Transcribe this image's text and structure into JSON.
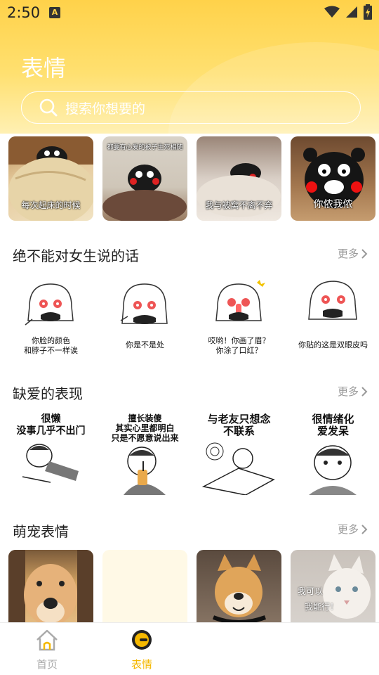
{
  "status_bar": {
    "time": "2:50",
    "notification_letter": "A"
  },
  "header": {
    "title": "表情",
    "search_placeholder": "搜索你想要的"
  },
  "top_thumbs": [
    {
      "caption": "每次起床的时候"
    },
    {
      "caption": "都要有心爱的被子生死相随"
    },
    {
      "caption": "我与被窝不离不弃"
    },
    {
      "caption": "你侬我侬"
    }
  ],
  "sections": [
    {
      "title": "绝不能对女生说的话",
      "more": "更多",
      "items": [
        {
          "lines": [
            "你脸的颜色",
            "和脖子不一样诶"
          ]
        },
        {
          "lines": [
            "你是不是处"
          ]
        },
        {
          "lines": [
            "哎哟！你画了眉？",
            "你涂了口红？"
          ]
        },
        {
          "lines": [
            "你贴的这是双眼皮吗"
          ]
        }
      ]
    },
    {
      "title": "缺爱的表现",
      "more": "更多",
      "items": [
        {
          "lines": [
            "很懒",
            "没事几乎不出门"
          ]
        },
        {
          "lines": [
            "擅长装傻",
            "其实心里都明白",
            "只是不愿意说出来"
          ]
        },
        {
          "lines": [
            "与老友只想念",
            "不联系"
          ]
        },
        {
          "lines": [
            "很情绪化",
            "爱发呆"
          ]
        }
      ]
    },
    {
      "title": "萌宠表情",
      "more": "更多",
      "items": [
        {
          "lines": []
        },
        {
          "lines": []
        },
        {
          "lines": []
        },
        {
          "lines": [
            "我可以",
            "我能行！"
          ]
        }
      ]
    }
  ],
  "bottom_nav": [
    {
      "label": "首页",
      "active": false,
      "icon": "home-icon"
    },
    {
      "label": "表情",
      "active": true,
      "icon": "emoji-face-icon"
    }
  ],
  "colors": {
    "accent": "#f5b800",
    "header_top": "#ffd24a",
    "inactive": "#aaaaaa"
  }
}
